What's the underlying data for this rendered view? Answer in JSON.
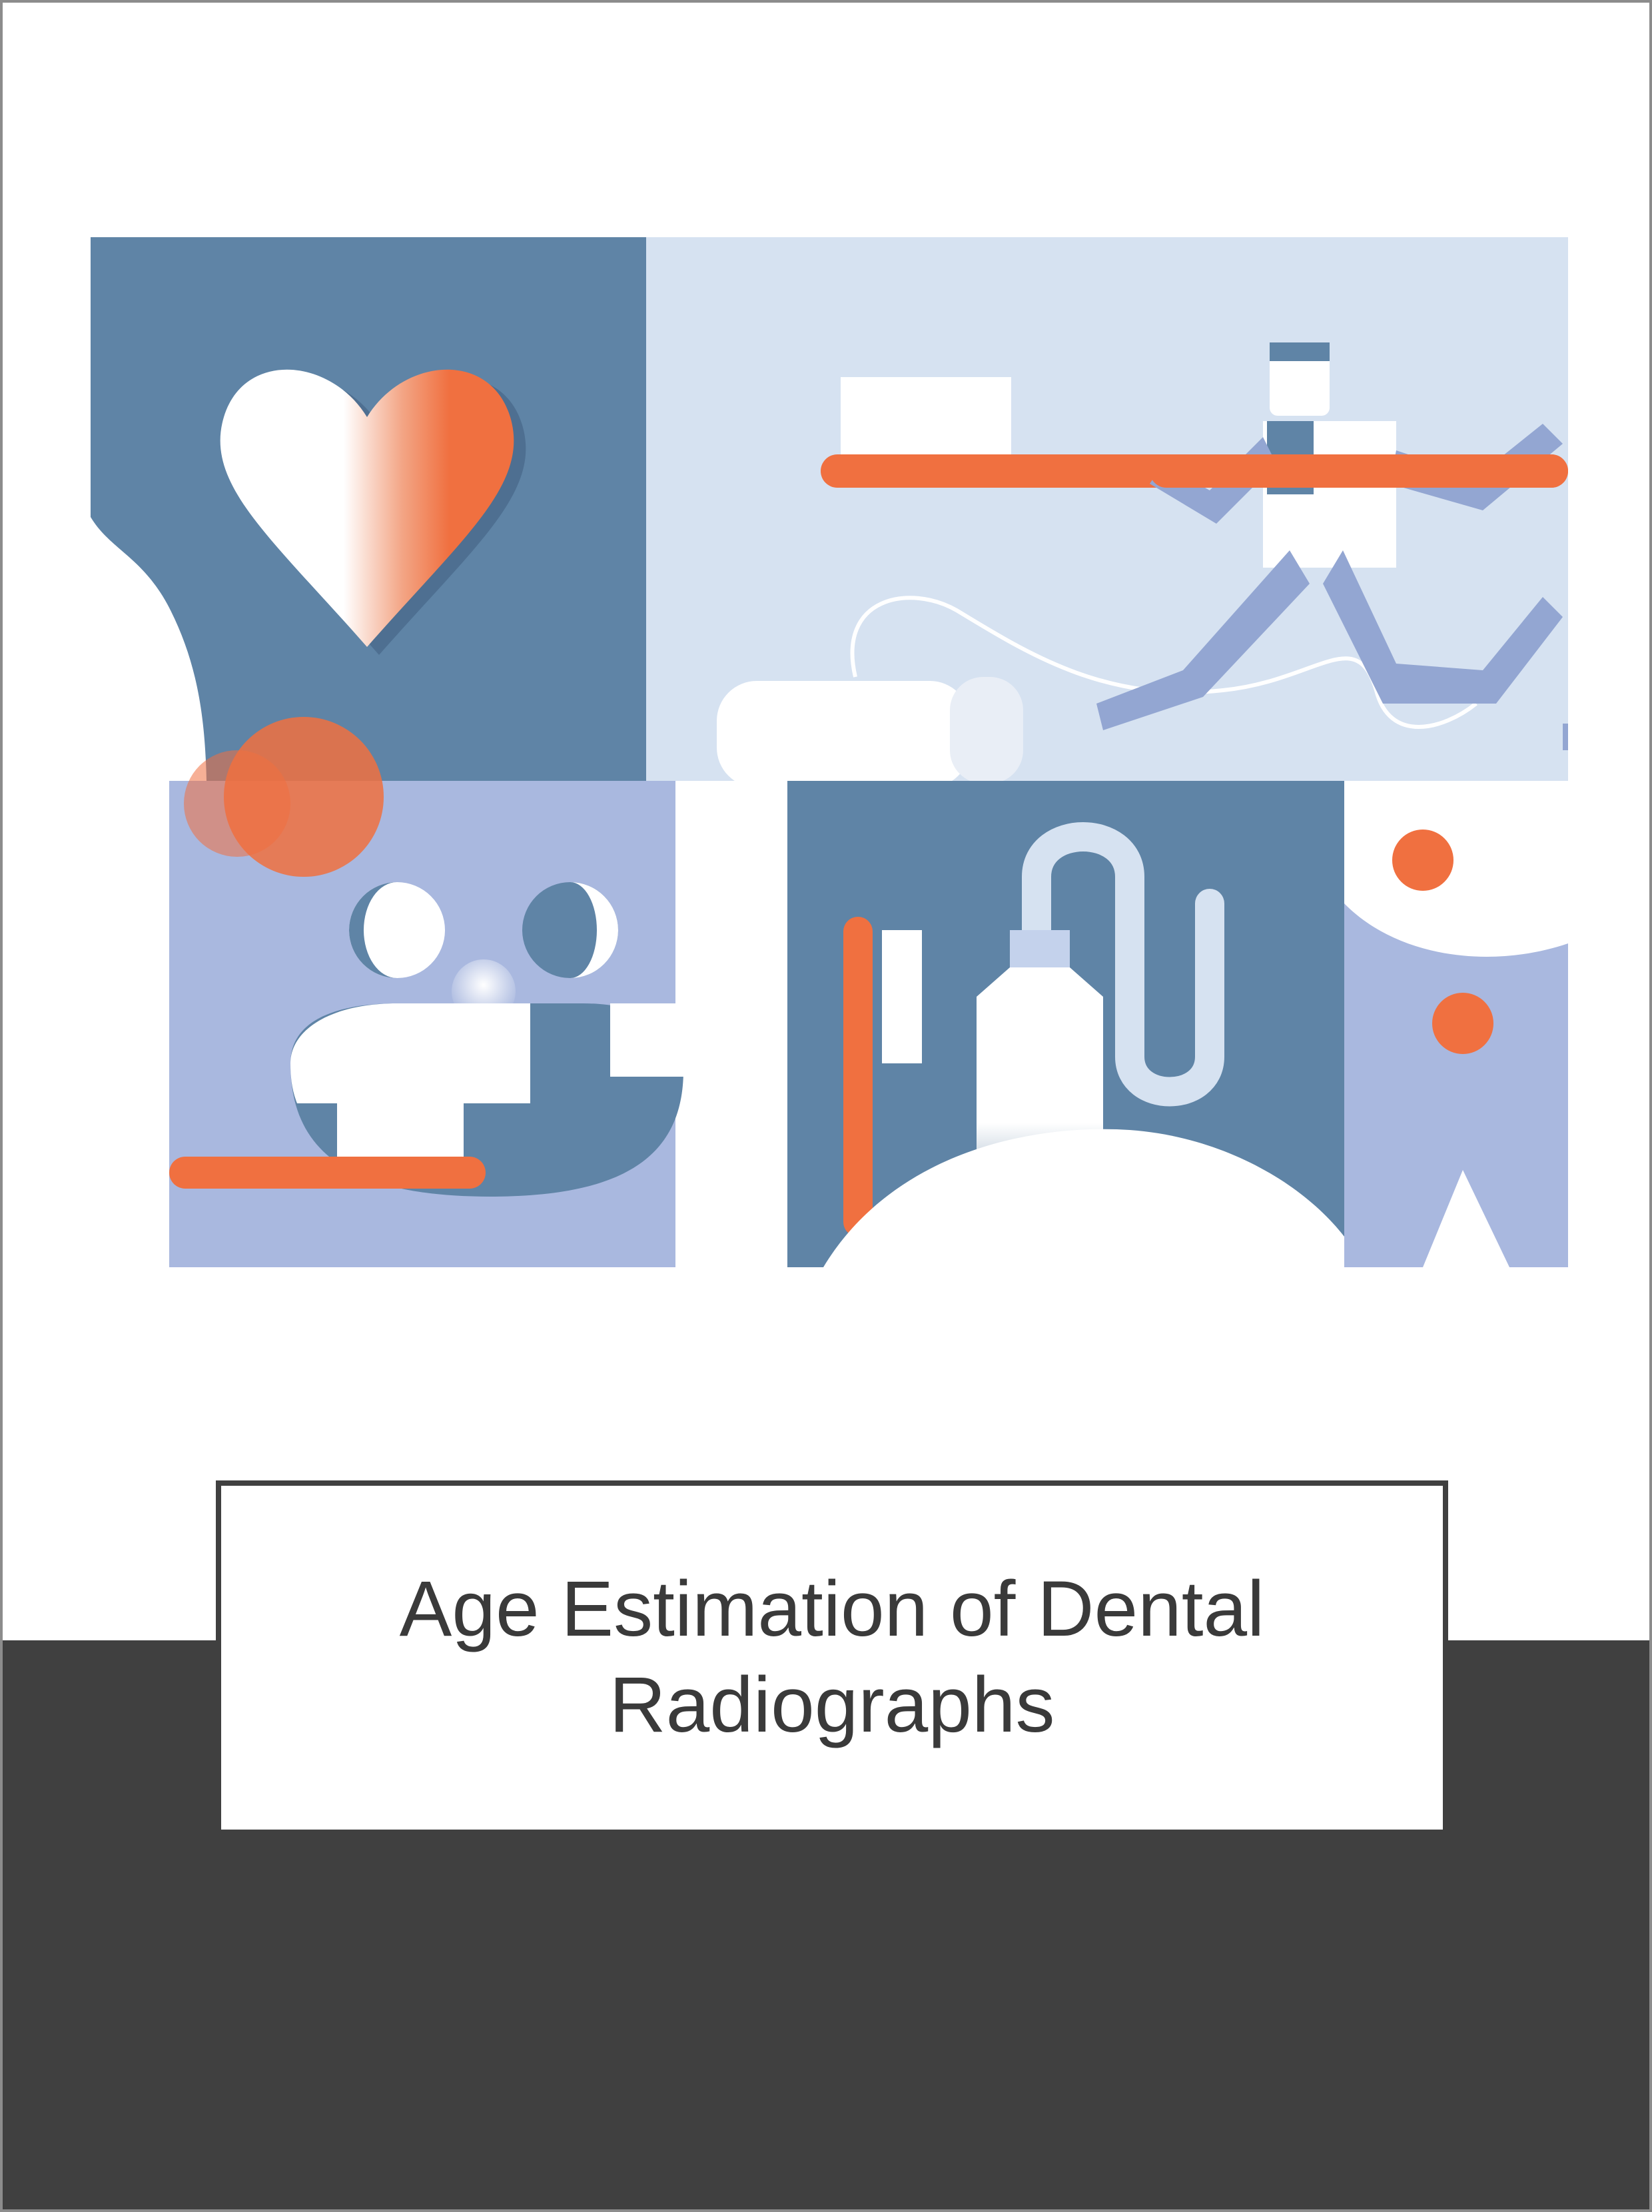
{
  "cover": {
    "title": "Age Estimation of Dental Radiographs"
  },
  "colors": {
    "background": "#ffffff",
    "band": "#404040",
    "slate_blue": "#5f84a6",
    "pale_blue": "#d6e2f1",
    "lavender": "#a9b8df",
    "orange": "#f07040",
    "white": "#ffffff",
    "border": "#8c8c8c"
  },
  "icons": [
    "heart-icon",
    "toothbrush-icon",
    "running-figure-icon",
    "tooth-face-icon",
    "sparkle-icon",
    "toothpaste-tube-icon"
  ]
}
